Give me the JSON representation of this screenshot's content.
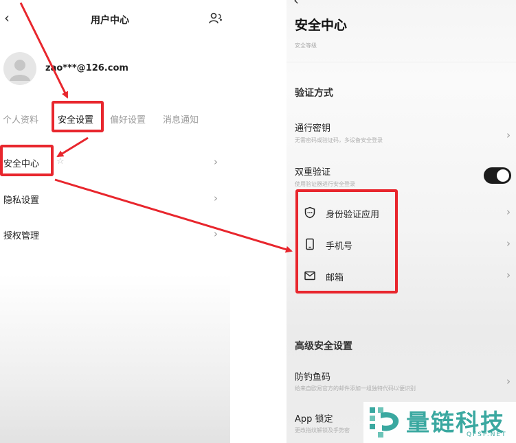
{
  "left_panel": {
    "header": {
      "back_icon": "chevron-left-icon",
      "title": "用户中心",
      "people_icon": "user-group-icon"
    },
    "profile": {
      "avatar_icon": "avatar-icon",
      "email": "zao***@126.com"
    },
    "tabs": [
      {
        "label": "个人资料"
      },
      {
        "label": "安全设置"
      },
      {
        "label": "偏好设置"
      },
      {
        "label": "消息通知"
      }
    ],
    "menu": [
      {
        "label": "安全中心"
      },
      {
        "label": "隐私设置"
      },
      {
        "label": "授权管理"
      }
    ]
  },
  "right_panel": {
    "back_icon": "chevron-left-icon",
    "title": "安全中心",
    "level_label": "安全等级",
    "verify_section": {
      "title": "验证方式",
      "passkey": {
        "title": "通行密钥",
        "subtitle": "无需密码或验证码，多设备安全登录"
      },
      "two_factor": {
        "title": "双重验证",
        "subtitle": "使用验证器进行安全登录",
        "enabled": true
      },
      "methods": [
        {
          "icon": "shield-icon",
          "label": "身份验证应用"
        },
        {
          "icon": "phone-icon",
          "label": "手机号"
        },
        {
          "icon": "mail-icon",
          "label": "邮箱"
        }
      ]
    },
    "advanced_section": {
      "title": "高级安全设置",
      "anti_phishing": {
        "title": "防钓鱼码",
        "subtitle": "给来自欧易官方的邮件添加一组独特代码以便识别"
      },
      "app_lock": {
        "title": "App 锁定",
        "subtitle": "更改指纹解锁及手势密"
      }
    }
  },
  "watermark": {
    "text": "量链科技",
    "domain": "QFSP.NET",
    "color": "#3aa8a0"
  },
  "colors": {
    "annotation_red": "#e8262d",
    "toggle_on": "#1c1c1c"
  }
}
